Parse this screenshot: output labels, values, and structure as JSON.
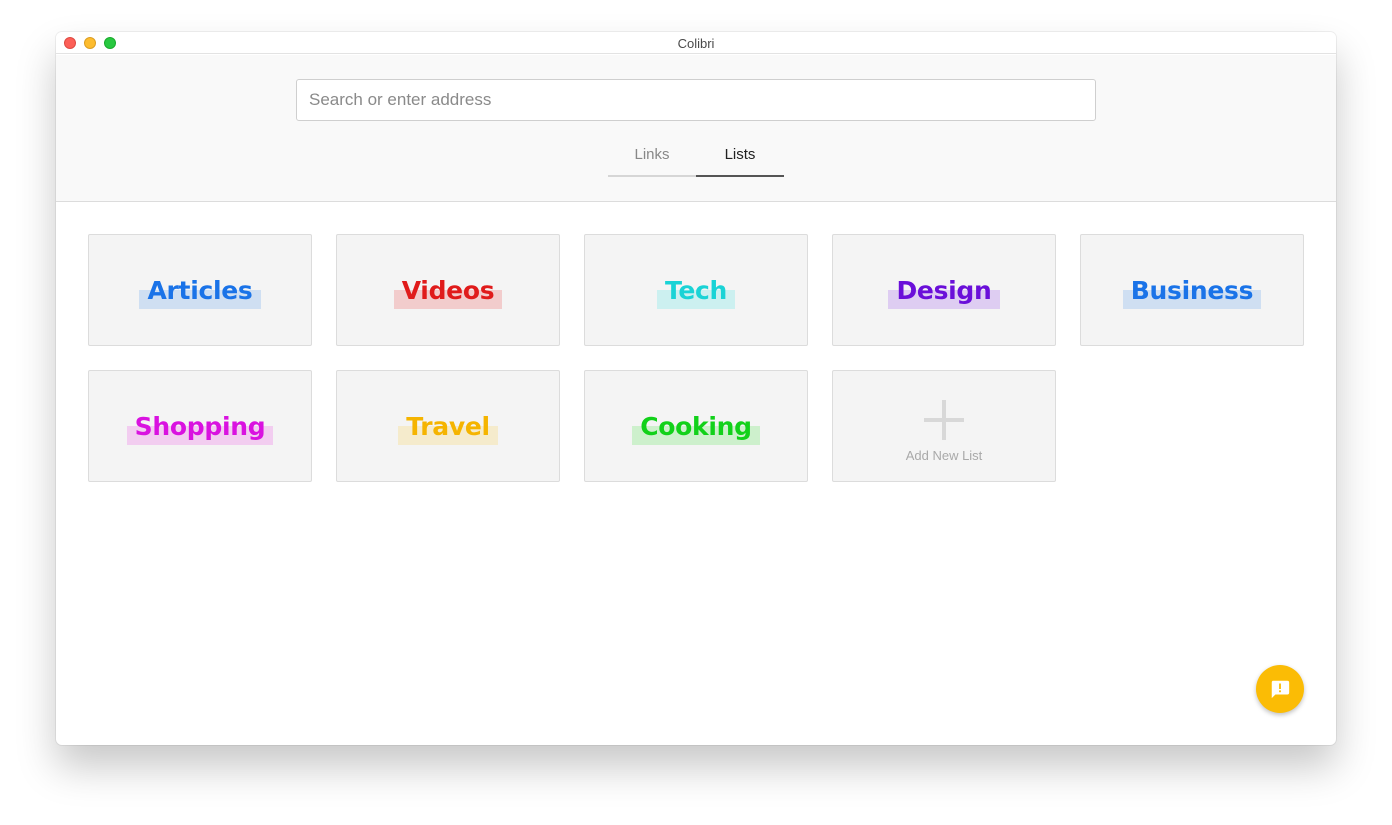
{
  "window": {
    "title": "Colibri"
  },
  "search": {
    "placeholder": "Search or enter address",
    "value": ""
  },
  "tabs": [
    {
      "label": "Links",
      "active": false
    },
    {
      "label": "Lists",
      "active": true
    }
  ],
  "lists": [
    {
      "label": "Articles",
      "color": "#1a73e8",
      "highlight": "#cfdff2"
    },
    {
      "label": "Videos",
      "color": "#e01b1b",
      "highlight": "#f2cccc"
    },
    {
      "label": "Tech",
      "color": "#1ad3d6",
      "highlight": "#ccf0f0"
    },
    {
      "label": "Design",
      "color": "#6a0fd9",
      "highlight": "#decdf2"
    },
    {
      "label": "Business",
      "color": "#1a73e8",
      "highlight": "#cfdff2"
    },
    {
      "label": "Shopping",
      "color": "#d912e0",
      "highlight": "#f2cdf0"
    },
    {
      "label": "Travel",
      "color": "#f5b400",
      "highlight": "#f5ebcc"
    },
    {
      "label": "Cooking",
      "color": "#12d11a",
      "highlight": "#cdf0cc"
    }
  ],
  "add_list": {
    "label": "Add New List",
    "icon": "plus-icon"
  },
  "fab": {
    "icon": "feedback-icon",
    "color": "#fbbc05"
  }
}
